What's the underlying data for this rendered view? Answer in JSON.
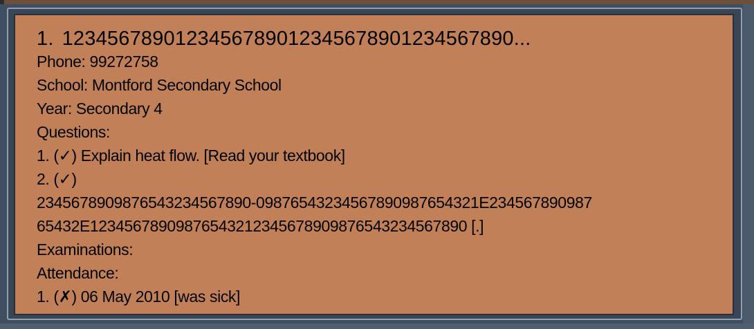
{
  "card": {
    "index": "1.",
    "name": "1234567890123456789012345678901234567890...",
    "phone": "Phone: 99272758",
    "school": "School: Montford Secondary School",
    "year": "Year: Secondary 4",
    "questions_label": "Questions:",
    "questions": [
      "1. (✓) Explain heat flow. [Read your textbook]",
      "2. (✓)",
      "234567890987654323456789​0-0987654323456789098765432​1E234567890987",
      "65432E12345678909876543212345678909876543​234567890 [.]"
    ],
    "examinations_label": "Examinations:",
    "attendance_label": "Attendance:",
    "attendance": [
      "1. (✗) 06 May 2010 [was sick]"
    ]
  },
  "colors": {
    "card_bg": "#c28059",
    "outer_bg": "#3f4f61",
    "border_light": "#8fa0b2",
    "border_dark": "#26313d"
  }
}
